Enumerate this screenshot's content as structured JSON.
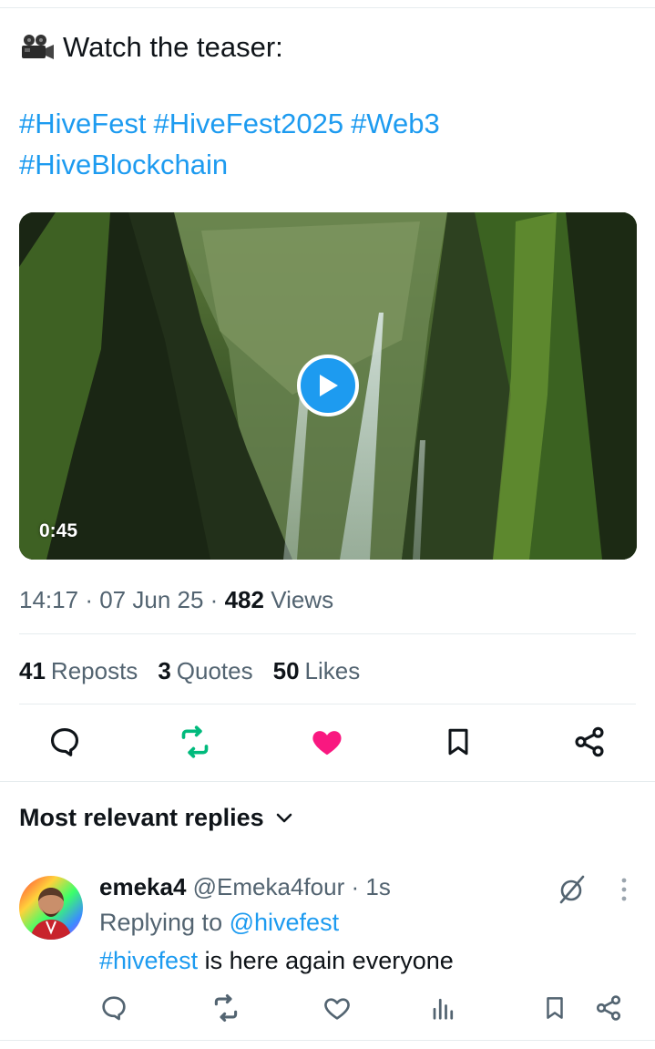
{
  "post": {
    "teaser_text": "Watch the teaser:",
    "hashtags": [
      "#HiveFest",
      "#HiveFest2025",
      "#Web3",
      "#HiveBlockchain"
    ],
    "video_duration": "0:45",
    "time": "14:17",
    "date": "07 Jun 25",
    "views_count": "482",
    "views_label": "Views",
    "sep": "·"
  },
  "stats": {
    "reposts_count": "41",
    "reposts_label": "Reposts",
    "quotes_count": "3",
    "quotes_label": "Quotes",
    "likes_count": "50",
    "likes_label": "Likes"
  },
  "replies_header": "Most relevant replies",
  "reply": {
    "name": "emeka4",
    "handle": "@Emeka4four",
    "time": "1s",
    "sep": "·",
    "replying_prefix": "Replying to",
    "replying_handle": "@hivefest",
    "text_tag": "#hivefest",
    "text_rest": " is here again everyone"
  },
  "colors": {
    "link": "#1d9bf0",
    "repost_active": "#00ba7c",
    "like_active": "#f91880",
    "muted": "#536471"
  },
  "icons": [
    "movie-camera-icon",
    "play-icon",
    "reply-icon",
    "repost-icon",
    "like-icon",
    "bookmark-icon",
    "share-icon",
    "chevron-down-icon",
    "grok-icon",
    "more-icon",
    "views-icon"
  ]
}
